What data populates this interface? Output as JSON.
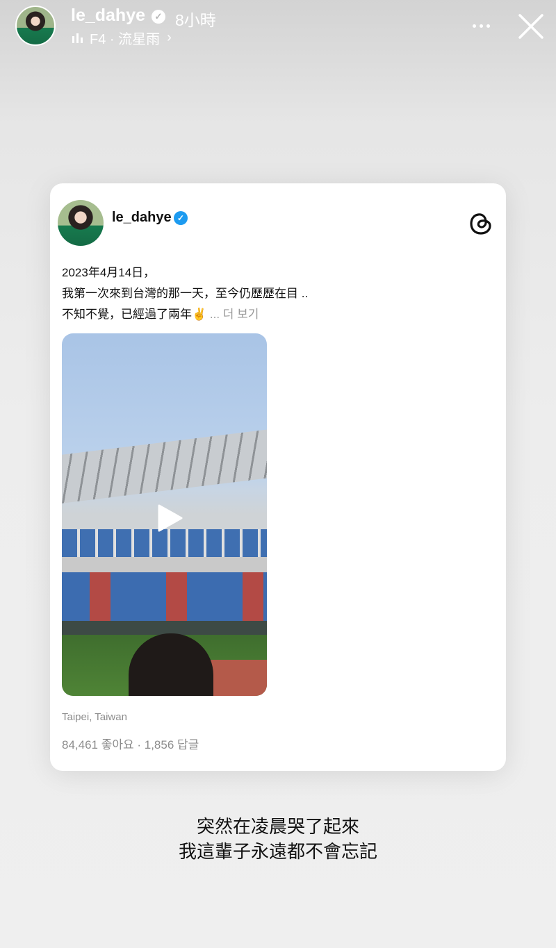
{
  "story_header": {
    "username": "le_dahye",
    "time_ago": "8小時",
    "music": "F4 · 流星雨",
    "chevron": "›"
  },
  "post": {
    "username": "le_dahye",
    "lines": [
      "2023年4月14日，",
      "我第一次來到台灣的那一天，至今仍歷歷在目 ..",
      "不知不覺，已經過了兩年✌️"
    ],
    "see_more": "... 더 보기",
    "location": "Taipei, Taiwan",
    "stats": "84,461 좋아요 · 1,856 답글"
  },
  "caption": {
    "line1": "突然在凌晨哭了起來",
    "line2": "我這輩子永遠都不會忘記"
  },
  "colors": {
    "verified_badge": "#1d9bf0",
    "muted_text": "#8c8c8c"
  },
  "icons": [
    "verified-icon",
    "music-bars-icon",
    "more-icon",
    "close-icon",
    "threads-icon",
    "play-icon"
  ]
}
